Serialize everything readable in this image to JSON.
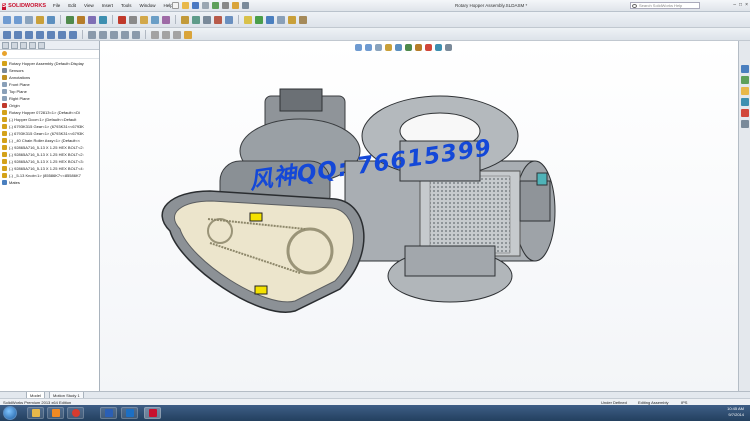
{
  "app": {
    "logo_mark": "S",
    "logo_text": "SOLIDWORKS",
    "document_title": "Rotary Hopper Assembly.SLDASM *"
  },
  "menu": {
    "items": [
      "File",
      "Edit",
      "View",
      "Insert",
      "Tools",
      "Window",
      "Help"
    ]
  },
  "search": {
    "placeholder": "Search SolidWorks Help"
  },
  "window_controls": {
    "minimize": "–",
    "maximize": "□",
    "close": "×"
  },
  "tree": {
    "items": [
      {
        "label": "Rotary Hopper Assembly (Default<Display",
        "icon": "assembly-icon",
        "color": "#d4a21a"
      },
      {
        "label": "Sensors",
        "icon": "sensors-icon",
        "color": "#7a8a9a"
      },
      {
        "label": "Annotations",
        "icon": "annotations-icon",
        "color": "#c09020"
      },
      {
        "label": "Front Plane",
        "icon": "plane-icon",
        "color": "#8aa0b8"
      },
      {
        "label": "Top Plane",
        "icon": "plane-icon",
        "color": "#8aa0b8"
      },
      {
        "label": "Right Plane",
        "icon": "plane-icon",
        "color": "#8aa0b8"
      },
      {
        "label": "Origin",
        "icon": "origin-icon",
        "color": "#c0392b"
      },
      {
        "label": "Rotary Hopper 072813<1> (Default<<Di",
        "icon": "part-icon",
        "color": "#d4a21a"
      },
      {
        "label": "(-) Hopper Door<1> (Default<<Default",
        "icon": "part-icon",
        "color": "#d4a21a"
      },
      {
        "label": "(-) 6793K315 Gear<1> (6793K31<<6793K",
        "icon": "part-icon",
        "color": "#d4a21a"
      },
      {
        "label": "(-) 6793K315 Gear<1> (6793K31<<6793K",
        "icon": "part-icon",
        "color": "#d4a21a"
      },
      {
        "label": "(-) _40 Chain Roller Assy<1> (Default<<",
        "icon": "part-icon",
        "color": "#d4a21a"
      },
      {
        "label": "(-) 92865A716_5-13 X 1.25 HEX BOLT<2:",
        "icon": "part-icon",
        "color": "#d4a21a"
      },
      {
        "label": "(-) 92865A716_5-13 X 1.25 HEX BOLT<2:",
        "icon": "part-icon",
        "color": "#d4a21a"
      },
      {
        "label": "(-) 92865A716_5-13 X 1.25 HEX BOLT<3:",
        "icon": "part-icon",
        "color": "#d4a21a"
      },
      {
        "label": "(-) 92865A716_5-13 X 1.25 HEX BOLT<4:",
        "icon": "part-icon",
        "color": "#d4a21a"
      },
      {
        "label": "(-) _5-13 Knob<1> (85586K7<<85586K7",
        "icon": "part-icon",
        "color": "#d4a21a"
      },
      {
        "label": "Mates",
        "icon": "mates-icon",
        "color": "#4a7fbf"
      }
    ]
  },
  "tabs": {
    "model": "Model",
    "motion": "Motion Study 1"
  },
  "status": {
    "edition": "SolidWorks Premium 2013 x64 Edition",
    "state1": "Under Defined",
    "state2": "Editing Assembly",
    "units": "IPS"
  },
  "taskbar": {
    "time": "10:45 AM",
    "date": "9/7/2014",
    "apps": [
      "windows-explorer-icon",
      "media-player-icon",
      "chrome-icon",
      "word-icon",
      "outlook-icon",
      "solidworks-icon"
    ]
  },
  "watermark": {
    "text": "风神QQ: 76615399"
  },
  "colors": {
    "accent": "#c8102e",
    "watermark": "#1448d8",
    "hopper": "#b8bcc0",
    "guard": "#e9e0c6"
  }
}
